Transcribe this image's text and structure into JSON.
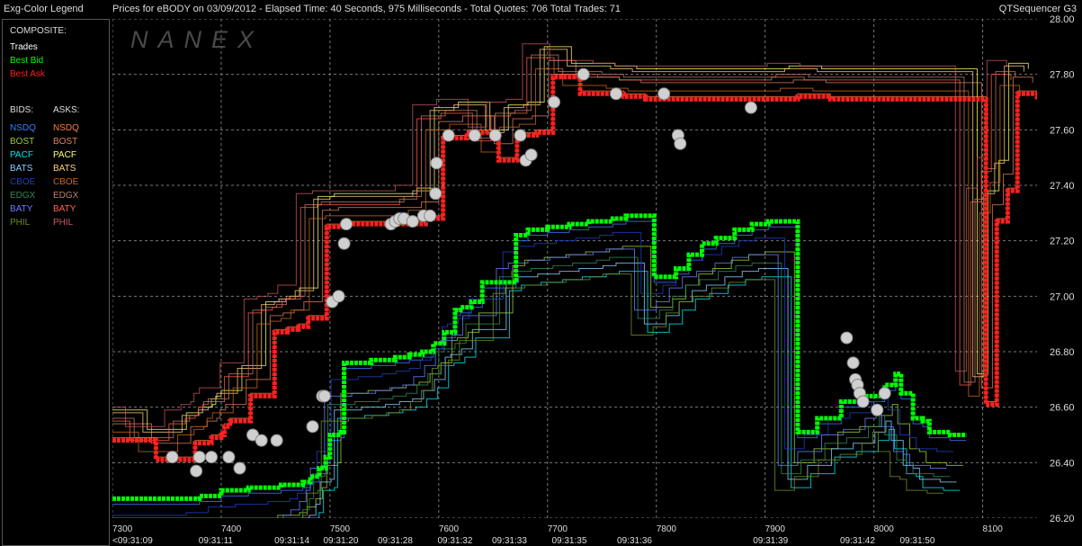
{
  "header": {
    "legend_title": "Exg-Color Legend",
    "chart_title": "Prices for  eBODY  on  03/09/2012  -  Elapsed Time: 40 Seconds, 975 Milliseconds  -  Total Quotes: 706  Total Trades: 71",
    "app_name": "QTSequencer G3"
  },
  "legend": {
    "composite_label": "COMPOSITE:",
    "trades_label": "Trades",
    "best_bid_label": "Best Bid",
    "best_ask_label": "Best Ask",
    "bids_header": "BIDS:",
    "asks_header": "ASKS:",
    "bids": [
      {
        "label": "NSDQ",
        "color": "#3a7bff"
      },
      {
        "label": "BOST",
        "color": "#9acd32"
      },
      {
        "label": "PACF",
        "color": "#00e5ee"
      },
      {
        "label": "BATS",
        "color": "#87cefa"
      },
      {
        "label": "CBOE",
        "color": "#1e3fbf"
      },
      {
        "label": "EDGX",
        "color": "#2e8b57"
      },
      {
        "label": "BATY",
        "color": "#6a7cff"
      },
      {
        "label": "PHIL",
        "color": "#6b8e23"
      }
    ],
    "asks": [
      {
        "label": "NSDQ",
        "color": "#ff7f3f"
      },
      {
        "label": "BOST",
        "color": "#e08060"
      },
      {
        "label": "PACF",
        "color": "#ffff66"
      },
      {
        "label": "BATS",
        "color": "#ffd27f"
      },
      {
        "label": "CBOE",
        "color": "#d2691e"
      },
      {
        "label": "EDGX",
        "color": "#c08070"
      },
      {
        "label": "BATY",
        "color": "#ff6347"
      },
      {
        "label": "PHIL",
        "color": "#cc5566"
      }
    ],
    "colors": {
      "trades": "#ffffff",
      "best_bid": "#00ff00",
      "best_ask": "#ff2020"
    }
  },
  "watermark": "NANEX",
  "chart_data": {
    "type": "line",
    "y_range": [
      26.2,
      28.0
    ],
    "y_ticks": [
      "28.00",
      "27.80",
      "27.60",
      "27.40",
      "27.20",
      "27.00",
      "26.80",
      "26.60",
      "26.40",
      "26.20"
    ],
    "x_range": [
      7300,
      8150
    ],
    "x_ticks": [
      {
        "seq": 7300,
        "label": "7300"
      },
      {
        "seq": 7400,
        "label": "7400"
      },
      {
        "seq": 7500,
        "label": "7500"
      },
      {
        "seq": 7600,
        "label": "7600"
      },
      {
        "seq": 7700,
        "label": "7700"
      },
      {
        "seq": 7800,
        "label": "7800"
      },
      {
        "seq": 7900,
        "label": "7900"
      },
      {
        "seq": 8000,
        "label": "8000"
      },
      {
        "seq": 8100,
        "label": "8100"
      }
    ],
    "time_labels": [
      {
        "seq": 7300,
        "label": "<09:31:09"
      },
      {
        "seq": 7395,
        "label": "09:31:11"
      },
      {
        "seq": 7465,
        "label": "09:31:14"
      },
      {
        "seq": 7510,
        "label": "09:31:20"
      },
      {
        "seq": 7560,
        "label": "09:31:28"
      },
      {
        "seq": 7615,
        "label": "09:31:32"
      },
      {
        "seq": 7665,
        "label": "09:31:33"
      },
      {
        "seq": 7720,
        "label": "09:31:35"
      },
      {
        "seq": 7780,
        "label": "09:31:36"
      },
      {
        "seq": 7905,
        "label": "09:31:39"
      },
      {
        "seq": 7985,
        "label": "09:31:42"
      },
      {
        "seq": 8040,
        "label": "09:31:50"
      }
    ],
    "series": [
      {
        "name": "Best Bid",
        "values": [
          [
            7300,
            26.27
          ],
          [
            7370,
            26.27
          ],
          [
            7380,
            26.28
          ],
          [
            7400,
            26.3
          ],
          [
            7425,
            26.31
          ],
          [
            7455,
            26.32
          ],
          [
            7475,
            26.33
          ],
          [
            7482,
            26.35
          ],
          [
            7490,
            26.38
          ],
          [
            7496,
            26.42
          ],
          [
            7500,
            26.5
          ],
          [
            7510,
            26.51
          ],
          [
            7513,
            26.76
          ],
          [
            7535,
            26.76
          ],
          [
            7538,
            26.77
          ],
          [
            7560,
            26.78
          ],
          [
            7573,
            26.79
          ],
          [
            7585,
            26.8
          ],
          [
            7595,
            26.83
          ],
          [
            7605,
            26.87
          ],
          [
            7615,
            26.95
          ],
          [
            7620,
            26.96
          ],
          [
            7630,
            26.98
          ],
          [
            7640,
            27.05
          ],
          [
            7660,
            27.05
          ],
          [
            7671,
            27.22
          ],
          [
            7682,
            27.24
          ],
          [
            7700,
            27.25
          ],
          [
            7720,
            27.26
          ],
          [
            7738,
            27.27
          ],
          [
            7760,
            27.28
          ],
          [
            7772,
            27.29
          ],
          [
            7792,
            27.29
          ],
          [
            7798,
            27.07
          ],
          [
            7818,
            27.1
          ],
          [
            7830,
            27.15
          ],
          [
            7842,
            27.19
          ],
          [
            7855,
            27.21
          ],
          [
            7872,
            27.24
          ],
          [
            7888,
            27.26
          ],
          [
            7903,
            27.27
          ],
          [
            7920,
            27.27
          ],
          [
            7930,
            26.51
          ],
          [
            7948,
            26.56
          ],
          [
            7970,
            26.62
          ],
          [
            7990,
            26.64
          ],
          [
            8010,
            26.68
          ],
          [
            8020,
            26.72
          ],
          [
            8025,
            26.65
          ],
          [
            8036,
            26.56
          ],
          [
            8045,
            26.55
          ],
          [
            8051,
            26.51
          ],
          [
            8070,
            26.5
          ],
          [
            8085,
            26.5
          ]
        ]
      },
      {
        "name": "Best Ask",
        "values": [
          [
            7300,
            26.48
          ],
          [
            7330,
            26.48
          ],
          [
            7340,
            26.41
          ],
          [
            7365,
            26.41
          ],
          [
            7376,
            26.47
          ],
          [
            7391,
            26.49
          ],
          [
            7400,
            26.5
          ],
          [
            7403,
            26.53
          ],
          [
            7408,
            26.55
          ],
          [
            7427,
            26.64
          ],
          [
            7449,
            26.87
          ],
          [
            7461,
            26.88
          ],
          [
            7471,
            26.89
          ],
          [
            7480,
            26.92
          ],
          [
            7497,
            27.25
          ],
          [
            7512,
            27.26
          ],
          [
            7555,
            27.26
          ],
          [
            7580,
            27.26
          ],
          [
            7588,
            27.28
          ],
          [
            7598,
            27.28
          ],
          [
            7604,
            27.57
          ],
          [
            7622,
            27.57
          ],
          [
            7626,
            27.59
          ],
          [
            7650,
            27.59
          ],
          [
            7655,
            27.49
          ],
          [
            7669,
            27.49
          ],
          [
            7672,
            27.58
          ],
          [
            7690,
            27.59
          ],
          [
            7705,
            27.79
          ],
          [
            7720,
            27.79
          ],
          [
            7730,
            27.73
          ],
          [
            7770,
            27.72
          ],
          [
            7790,
            27.71
          ],
          [
            7830,
            27.71
          ],
          [
            7880,
            27.71
          ],
          [
            7905,
            27.71
          ],
          [
            7925,
            27.71
          ],
          [
            7930,
            27.72
          ],
          [
            7960,
            27.71
          ],
          [
            8000,
            27.71
          ],
          [
            8050,
            27.71
          ],
          [
            8090,
            27.71
          ],
          [
            8103,
            26.61
          ],
          [
            8111,
            26.61
          ],
          [
            8113,
            27.27
          ],
          [
            8119,
            27.27
          ],
          [
            8123,
            27.38
          ],
          [
            8128,
            27.38
          ],
          [
            8132,
            27.73
          ],
          [
            8150,
            27.71
          ]
        ]
      },
      {
        "name": "Trades",
        "values": [
          [
            7355,
            26.42
          ],
          [
            7377,
            26.37
          ],
          [
            7380,
            26.42
          ],
          [
            7391,
            26.42
          ],
          [
            7407,
            26.42
          ],
          [
            7417,
            26.38
          ],
          [
            7429,
            26.5
          ],
          [
            7437,
            26.48
          ],
          [
            7451,
            26.48
          ],
          [
            7484,
            26.53
          ],
          [
            7493,
            26.64
          ],
          [
            7495,
            26.64
          ],
          [
            7502,
            26.98
          ],
          [
            7508,
            27.0
          ],
          [
            7513,
            27.19
          ],
          [
            7515,
            27.26
          ],
          [
            7556,
            27.26
          ],
          [
            7560,
            27.27
          ],
          [
            7564,
            27.28
          ],
          [
            7568,
            27.28
          ],
          [
            7576,
            27.27
          ],
          [
            7586,
            27.29
          ],
          [
            7592,
            27.29
          ],
          [
            7597,
            27.37
          ],
          [
            7598,
            27.48
          ],
          [
            7609,
            27.58
          ],
          [
            7633,
            27.58
          ],
          [
            7652,
            27.58
          ],
          [
            7675,
            27.58
          ],
          [
            7680,
            27.49
          ],
          [
            7685,
            27.51
          ],
          [
            7706,
            27.7
          ],
          [
            7733,
            27.8
          ],
          [
            7763,
            27.73
          ],
          [
            7807,
            27.73
          ],
          [
            7820,
            27.58
          ],
          [
            7822,
            27.55
          ],
          [
            7887,
            27.68
          ],
          [
            7975,
            26.85
          ],
          [
            7981,
            26.76
          ],
          [
            7983,
            26.7
          ],
          [
            7985,
            26.68
          ],
          [
            7987,
            26.65
          ],
          [
            7990,
            26.62
          ],
          [
            8003,
            26.59
          ],
          [
            8010,
            26.65
          ]
        ]
      }
    ]
  }
}
